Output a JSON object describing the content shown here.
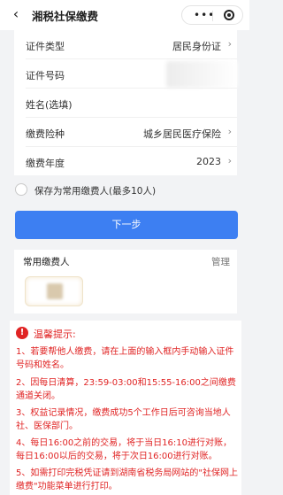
{
  "nav": {
    "back_glyph": "‹",
    "title": "湘税社保缴费",
    "more_glyph": "•••"
  },
  "form": {
    "rows": [
      {
        "label": "证件类型",
        "value": "居民身份证",
        "has_arrow": true
      },
      {
        "label": "证件号码",
        "value": "",
        "blurred": true
      },
      {
        "label": "姓名(选填)",
        "value": ""
      },
      {
        "label": "缴费险种",
        "value": "城乡居民医疗保险",
        "has_arrow": true
      },
      {
        "label": "缴费年度",
        "value": "2023",
        "has_arrow": true
      }
    ],
    "arrow_glyph": "›"
  },
  "save_payer": {
    "label": "保存为常用缴费人(最多10人)",
    "checked": false
  },
  "next_button": "下一步",
  "common_payers": {
    "title": "常用缴费人",
    "manage": "管理"
  },
  "tips": {
    "icon_glyph": "!",
    "title": "温馨提示:",
    "items": [
      "1、若要帮他人缴费，请在上面的输入框内手动输入证件号码和姓名。",
      "2、因每日清算，23:59-03:00和15:55-16:00之间缴费通道关闭。",
      "3、权益记录情况，缴费成功5个工作日后可咨询当地人社、医保部门。",
      "4、每日16:00之前的交易，将于当日16:10进行对账，每日16:00以后的交易，将于次日16:00进行对账。",
      "5、如需打印完税凭证请到湖南省税务局网站的\"社保网上缴费\"功能菜单进行打印。"
    ]
  },
  "colors": {
    "primary": "#3d7ff2",
    "warning": "#e02424",
    "background": "#f2f3f5"
  }
}
